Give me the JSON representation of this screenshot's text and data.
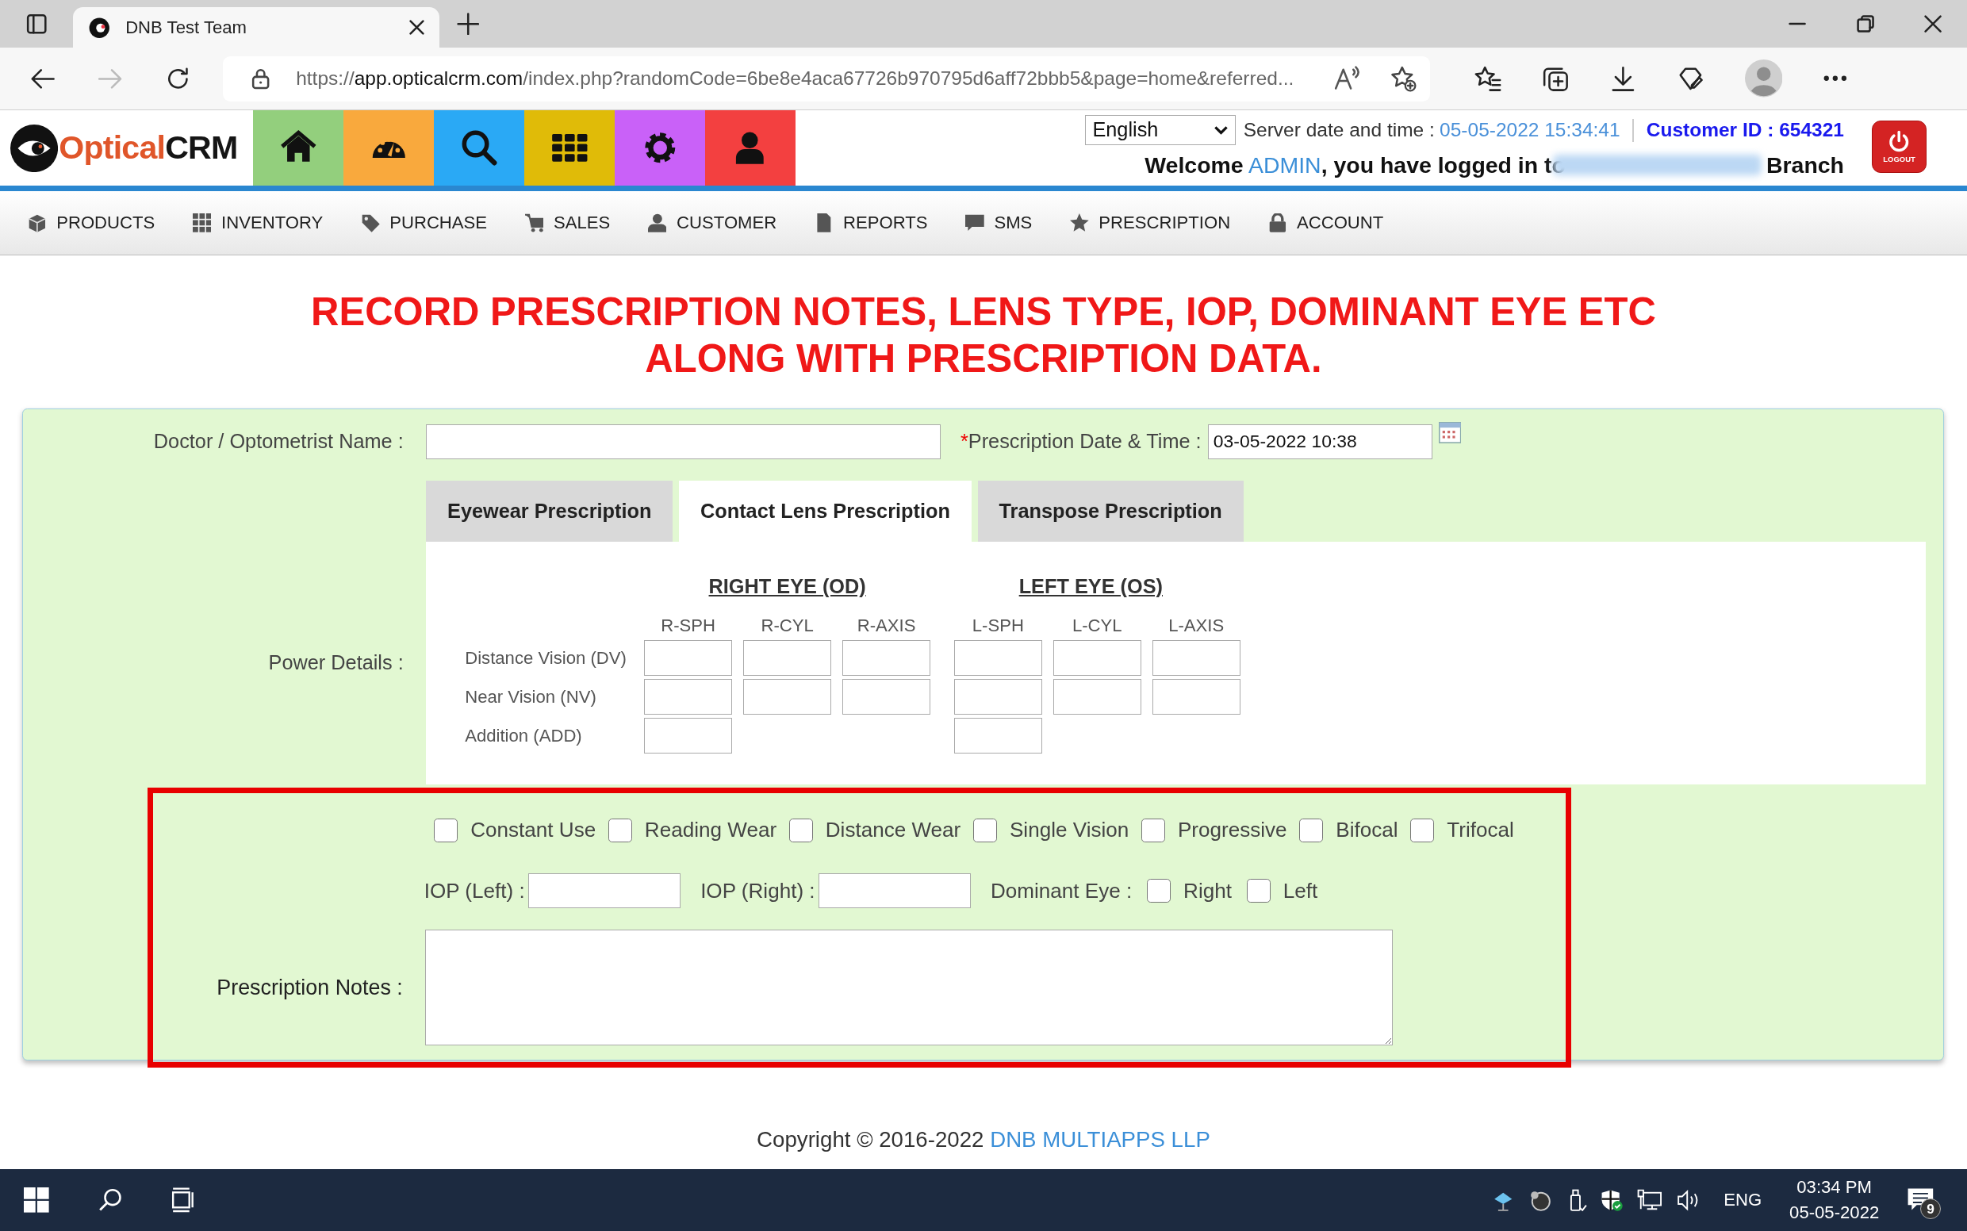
{
  "browser": {
    "tab_title": "DNB Test Team",
    "url": {
      "scheme": "https://",
      "host": "app.opticalcrm.com",
      "rest": "/index.php?randomCode=6be8e4aca67726b970795d6aff72bbb5&page=home&referred..."
    }
  },
  "header": {
    "logo": {
      "first": "Optical",
      "second": "CRM"
    },
    "tiles": [
      {
        "kind": "home",
        "color": "#93cf7d"
      },
      {
        "kind": "dashboard",
        "color": "#f9a93d"
      },
      {
        "kind": "search",
        "color": "#2aa9f5"
      },
      {
        "kind": "apps",
        "color": "#e0bb08"
      },
      {
        "kind": "settings",
        "color": "#c961f8"
      },
      {
        "kind": "user",
        "color": "#f34040"
      }
    ],
    "language": "English",
    "server_label": "Server date and time :",
    "server_time": "05-05-2022 15:34:41",
    "customer_id": "Customer ID : 654321",
    "welcome": {
      "before": "Welcome",
      "user": "ADMIN",
      "after": ", you have logged in to",
      "branch": "Branch"
    },
    "logout": "LOGOUT"
  },
  "nav": [
    {
      "kind": "box",
      "label": "PRODUCTS"
    },
    {
      "kind": "grid",
      "label": "INVENTORY"
    },
    {
      "kind": "tag",
      "label": "PURCHASE"
    },
    {
      "kind": "cart",
      "label": "SALES"
    },
    {
      "kind": "user",
      "label": "CUSTOMER"
    },
    {
      "kind": "file",
      "label": "REPORTS"
    },
    {
      "kind": "chat",
      "label": "SMS"
    },
    {
      "kind": "star",
      "label": "PRESCRIPTION"
    },
    {
      "kind": "lock",
      "label": "ACCOUNT"
    }
  ],
  "heading": [
    "RECORD PRESCRIPTION NOTES, LENS TYPE, IOP, DOMINANT EYE ETC",
    "ALONG WITH PRESCRIPTION DATA."
  ],
  "form": {
    "doctor_label": "Doctor / Optometrist Name :",
    "date_required": "*",
    "date_label": "Prescription Date & Time :",
    "date_value": "03-05-2022 10:38",
    "tabs": [
      {
        "label": "Eyewear Prescription",
        "selected": false
      },
      {
        "label": "Contact Lens Prescription",
        "selected": true
      },
      {
        "label": "Transpose Prescription",
        "selected": false
      }
    ],
    "power_label": "Power Details :",
    "right_eye": "RIGHT EYE (OD)",
    "left_eye": "LEFT EYE (OS)",
    "columns": [
      "R-SPH",
      "R-CYL",
      "R-AXIS",
      "L-SPH",
      "L-CYL",
      "L-AXIS"
    ],
    "rows": [
      {
        "label": "Distance Vision (DV)",
        "kind": "full"
      },
      {
        "label": "Near Vision (NV)",
        "kind": "full"
      },
      {
        "label": "Addition (ADD)",
        "kind": "sph"
      }
    ],
    "lens_options": [
      {
        "label": "Constant Use",
        "checked": false
      },
      {
        "label": "Reading Wear",
        "checked": false
      },
      {
        "label": "Distance Wear",
        "checked": false
      },
      {
        "label": "Single Vision",
        "checked": false
      },
      {
        "label": "Progressive",
        "checked": false
      },
      {
        "label": "Bifocal",
        "checked": false
      },
      {
        "label": "Trifocal",
        "checked": false
      }
    ],
    "iop_left": "IOP (Left) :",
    "iop_right": "IOP (Right) :",
    "dominant_label": "Dominant Eye :",
    "dominant_options": [
      {
        "label": "Right",
        "checked": false
      },
      {
        "label": "Left",
        "checked": false
      }
    ],
    "notes_label": "Prescription Notes :"
  },
  "footer": {
    "text": "Copyright © 2016-2022",
    "link": "DNB MULTIAPPS LLP"
  },
  "taskbar": {
    "language": "ENG",
    "time": "03:34 PM",
    "date": "05-05-2022",
    "notifications": "9"
  }
}
